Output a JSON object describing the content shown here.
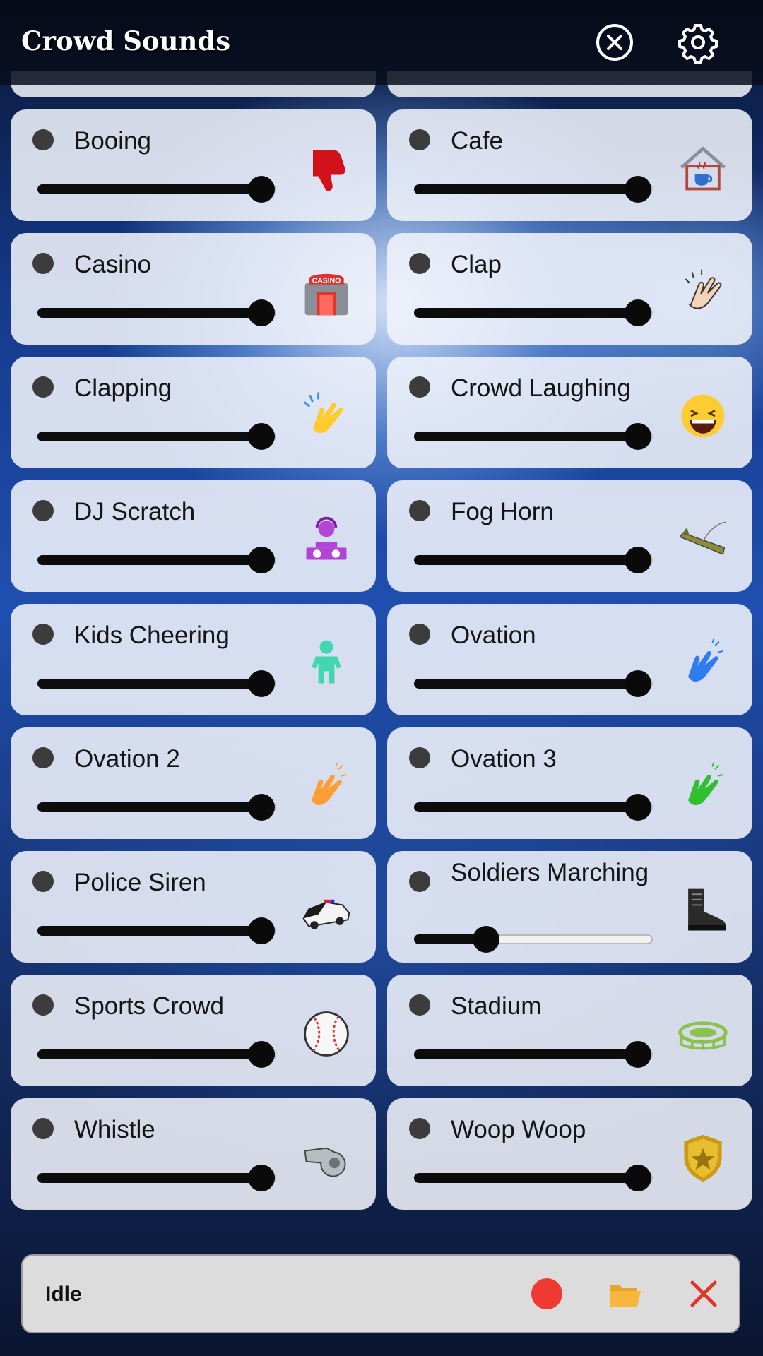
{
  "header": {
    "title": "Crowd Sounds",
    "close_icon": "circle-x-icon",
    "settings_icon": "gear-icon"
  },
  "sounds": [
    {
      "name": "Booing",
      "level": 1.0,
      "icon": "thumbs-down-icon"
    },
    {
      "name": "Cafe",
      "level": 1.0,
      "icon": "cafe-house-icon"
    },
    {
      "name": "Casino",
      "level": 1.0,
      "icon": "casino-building-icon"
    },
    {
      "name": "Clap",
      "level": 1.0,
      "icon": "clapping-hands-icon"
    },
    {
      "name": "Clapping",
      "level": 1.0,
      "icon": "clapping-hands-yellow-icon"
    },
    {
      "name": "Crowd Laughing",
      "level": 1.0,
      "icon": "laughing-face-icon"
    },
    {
      "name": "DJ Scratch",
      "level": 1.0,
      "icon": "dj-icon"
    },
    {
      "name": "Fog Horn",
      "level": 1.0,
      "icon": "horn-icon"
    },
    {
      "name": "Kids Cheering",
      "level": 1.0,
      "icon": "child-icon"
    },
    {
      "name": "Ovation",
      "level": 1.0,
      "icon": "clapping-hands-blue-icon"
    },
    {
      "name": "Ovation 2",
      "level": 1.0,
      "icon": "clapping-hands-orange-icon"
    },
    {
      "name": "Ovation 3",
      "level": 1.0,
      "icon": "clapping-hands-green-icon"
    },
    {
      "name": "Police Siren",
      "level": 1.0,
      "icon": "police-car-icon"
    },
    {
      "name": "Soldiers Marching",
      "level": 0.3,
      "icon": "boot-icon"
    },
    {
      "name": "Sports Crowd",
      "level": 1.0,
      "icon": "baseball-icon"
    },
    {
      "name": "Stadium",
      "level": 1.0,
      "icon": "stadium-icon"
    },
    {
      "name": "Whistle",
      "level": 1.0,
      "icon": "whistle-icon"
    },
    {
      "name": "Woop Woop",
      "level": 1.0,
      "icon": "police-badge-icon"
    }
  ],
  "footer": {
    "status": "Idle",
    "record_icon": "record-icon",
    "folder_icon": "folder-icon",
    "stop_icon": "x-icon"
  },
  "colors": {
    "record": "#ef3a33",
    "stop": "#e0352b",
    "folder": "#f6b73c"
  }
}
